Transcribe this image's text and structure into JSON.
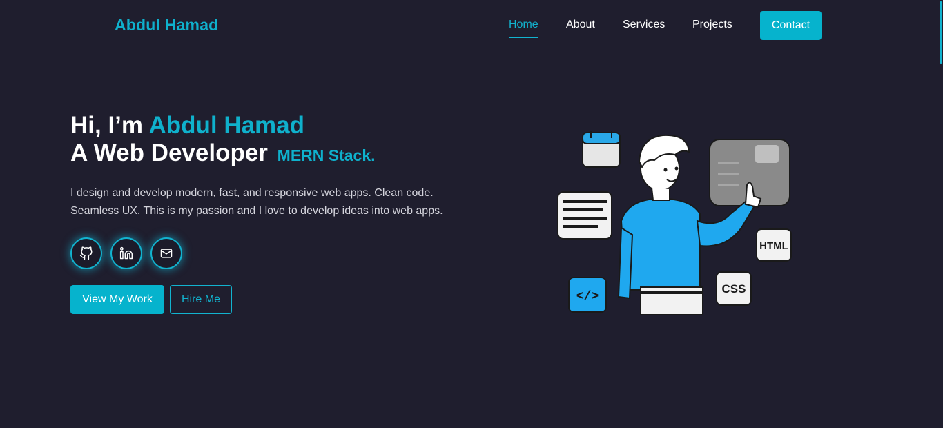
{
  "header": {
    "brand": "Abdul Hamad",
    "nav": [
      {
        "label": "Home",
        "active": true
      },
      {
        "label": "About"
      },
      {
        "label": "Services"
      },
      {
        "label": "Projects"
      }
    ],
    "contact_label": "Contact"
  },
  "hero": {
    "greeting": "Hi, I’m ",
    "name": "Abdul Hamad",
    "role": "A Web Developer",
    "stack": "MERN Stack.",
    "description_line1": "I design and develop modern, fast, and responsive web apps. Clean code.",
    "description_line2": "Seamless UX. This is my passion and I love to develop ideas into web apps.",
    "social": [
      {
        "icon": "github-icon"
      },
      {
        "icon": "linkedin-icon"
      },
      {
        "icon": "mail-icon"
      }
    ],
    "primary_cta": "View My Work",
    "secondary_cta": "Hire Me"
  },
  "illustration": {
    "badges": [
      "HTML",
      "CSS",
      "</>"
    ]
  },
  "colors": {
    "background": "#1f1e2e",
    "accent": "#0fb1cc",
    "text": "#ffffff",
    "muted_text": "#d4d4dc"
  }
}
